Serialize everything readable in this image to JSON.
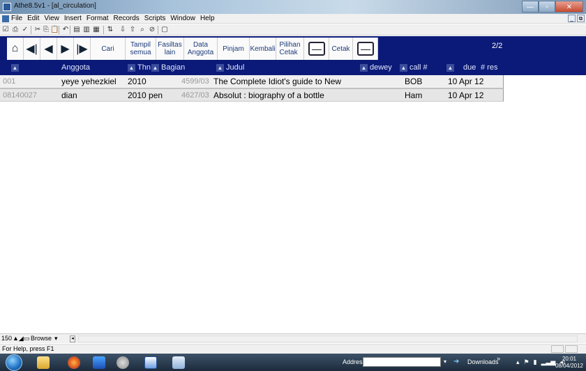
{
  "window": {
    "title": "Athe8.5v1 - [al_circulation]"
  },
  "menu": [
    "File",
    "Edit",
    "View",
    "Insert",
    "Format",
    "Records",
    "Scripts",
    "Window",
    "Help"
  ],
  "toolbar_icons": [
    "checkbox-icon",
    "print-icon",
    "spellcheck-icon",
    "cut-icon",
    "copy-icon",
    "paste-icon",
    "undo-icon",
    "new-record-icon",
    "duplicate-record-icon",
    "delete-record-icon",
    "sort-icon",
    "import-icon",
    "export-icon",
    "find-icon",
    "omit-icon",
    "preview-icon"
  ],
  "nav": {
    "buttons": [
      {
        "type": "icon",
        "name": "home-icon",
        "glyph": "⌂"
      },
      {
        "type": "icon",
        "name": "first-record-icon",
        "glyph": "⏮"
      },
      {
        "type": "icon",
        "name": "prev-record-icon",
        "glyph": "◀"
      },
      {
        "type": "icon",
        "name": "next-record-icon",
        "glyph": "▶"
      },
      {
        "type": "icon",
        "name": "last-record-icon",
        "glyph": "⏭"
      }
    ],
    "cari": "Cari",
    "tampil": [
      "Tampil",
      "semua"
    ],
    "fasiltas": [
      "Fasiltas",
      "lain"
    ],
    "data_anggota": [
      "Data",
      "Anggota"
    ],
    "pinjam": "Pinjam",
    "kembali": "Kembali",
    "pilihan_cetak": [
      "Pilihan",
      "Cetak"
    ],
    "cetak": "Cetak",
    "page": "2/2"
  },
  "columns": {
    "anggota": "Anggota",
    "thn": "Thn",
    "bagian": "Bagian",
    "judul": "Judul",
    "dewey": "dewey",
    "call": "call #",
    "due": "due",
    "res": "# res"
  },
  "rows": [
    {
      "id": "001",
      "anggota": "yeye yehezkiel",
      "thn": "2010",
      "bagian": "",
      "code": "4599/03",
      "judul": "The Complete Idiot's guide to New",
      "call": "BOB",
      "due": "10 Apr 12"
    },
    {
      "id": "08140027",
      "anggota": "dian",
      "thn": "2010 pen",
      "bagian": "",
      "code": "4627/03",
      "judul": "Absolut : biography of a bottle",
      "call": "Ham",
      "due": "10 Apr 12"
    }
  ],
  "status": {
    "zoom": "150",
    "mode": "Browse",
    "help": "For Help, press F1"
  },
  "taskbar": {
    "address_label": "Address",
    "downloads": "Downloads",
    "more": "»",
    "time": "20:01",
    "date": "08/04/2012"
  }
}
